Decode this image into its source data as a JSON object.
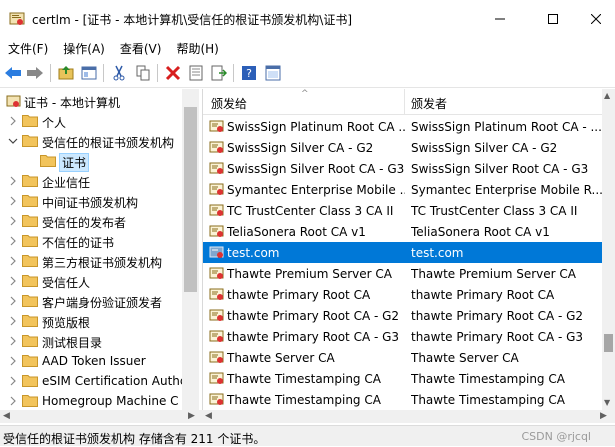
{
  "window": {
    "title": "certlm - [证书 - 本地计算机\\受信任的根证书颁发机构\\证书]"
  },
  "menu": [
    "文件(F)",
    "操作(A)",
    "查看(V)",
    "帮助(H)"
  ],
  "toolbar_icons": [
    "back-arrow-icon",
    "forward-arrow-icon",
    "up-folder-icon",
    "show-hide-tree-icon",
    "cut-icon",
    "copy-icon",
    "delete-icon",
    "properties-icon",
    "export-icon",
    "help-icon",
    "console-icon"
  ],
  "tree": {
    "root": "证书 - 本地计算机",
    "items": [
      {
        "label": "个人",
        "expanded": false
      },
      {
        "label": "受信任的根证书颁发机构",
        "expanded": true
      },
      {
        "label": "证书",
        "child": true,
        "selected": true
      },
      {
        "label": "企业信任",
        "expanded": false
      },
      {
        "label": "中间证书颁发机构",
        "expanded": false
      },
      {
        "label": "受信任的发布者",
        "expanded": false
      },
      {
        "label": "不信任的证书",
        "expanded": false
      },
      {
        "label": "第三方根证书颁发机构",
        "expanded": false
      },
      {
        "label": "受信任人",
        "expanded": false
      },
      {
        "label": "客户端身份验证颁发者",
        "expanded": false
      },
      {
        "label": "预览版根",
        "expanded": false
      },
      {
        "label": "测试根目录",
        "expanded": false
      },
      {
        "label": "AAD Token Issuer",
        "expanded": false
      },
      {
        "label": "eSIM Certification Authc",
        "expanded": false
      },
      {
        "label": "Homegroup Machine C",
        "expanded": false
      }
    ]
  },
  "list": {
    "columns": [
      "颁发给",
      "颁发者"
    ],
    "rows": [
      {
        "issued_to": "SwissSign Platinum Root CA ...",
        "issued_by": "SwissSign Platinum Root CA - ..."
      },
      {
        "issued_to": "SwissSign Silver CA - G2",
        "issued_by": "SwissSign Silver CA - G2"
      },
      {
        "issued_to": "SwissSign Silver Root CA - G3",
        "issued_by": "SwissSign Silver Root CA - G3"
      },
      {
        "issued_to": "Symantec Enterprise Mobile ...",
        "issued_by": "Symantec Enterprise Mobile R..."
      },
      {
        "issued_to": "TC TrustCenter Class 3 CA II",
        "issued_by": "TC TrustCenter Class 3 CA II"
      },
      {
        "issued_to": "TeliaSonera Root CA v1",
        "issued_by": "TeliaSonera Root CA v1"
      },
      {
        "issued_to": "test.com",
        "issued_by": "test.com",
        "selected": true
      },
      {
        "issued_to": "Thawte Premium Server CA",
        "issued_by": "Thawte Premium Server CA"
      },
      {
        "issued_to": "thawte Primary Root CA",
        "issued_by": "thawte Primary Root CA"
      },
      {
        "issued_to": "thawte Primary Root CA - G2",
        "issued_by": "thawte Primary Root CA - G2"
      },
      {
        "issued_to": "thawte Primary Root CA - G3",
        "issued_by": "thawte Primary Root CA - G3"
      },
      {
        "issued_to": "Thawte Server CA",
        "issued_by": "Thawte Server CA"
      },
      {
        "issued_to": "Thawte Timestamping CA",
        "issued_by": "Thawte Timestamping CA"
      },
      {
        "issued_to": "Thawte Timestamping CA",
        "issued_by": "Thawte Timestamping CA"
      }
    ]
  },
  "status": {
    "text": "受信任的根证书颁发机构 存储含有 211 个证书。",
    "watermark": "CSDN @rjcql"
  }
}
